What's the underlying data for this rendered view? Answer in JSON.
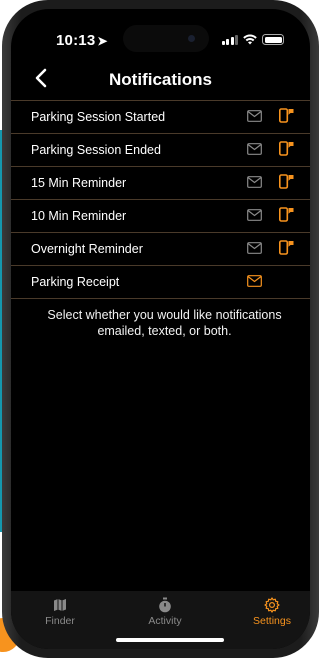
{
  "status_bar": {
    "time": "10:13"
  },
  "header": {
    "title": "Notifications"
  },
  "notification_rows": [
    {
      "label": "Parking Session Started",
      "email_enabled": false,
      "text_enabled": true
    },
    {
      "label": "Parking Session Ended",
      "email_enabled": false,
      "text_enabled": true
    },
    {
      "label": "15 Min Reminder",
      "email_enabled": false,
      "text_enabled": true
    },
    {
      "label": "10 Min Reminder",
      "email_enabled": false,
      "text_enabled": true
    },
    {
      "label": "Overnight Reminder",
      "email_enabled": false,
      "text_enabled": true
    },
    {
      "label": "Parking Receipt",
      "email_enabled": true,
      "text_enabled": false
    }
  ],
  "helper_text": "Select whether you would like notifications emailed, texted, or both.",
  "tabs": [
    {
      "label": "Finder",
      "icon": "map-icon"
    },
    {
      "label": "Activity",
      "icon": "stopwatch-icon"
    },
    {
      "label": "Settings",
      "icon": "gear-icon",
      "active": true
    }
  ],
  "colors": {
    "accent": "#f7931e",
    "inactive_icon": "#8a8a8a",
    "background": "#000000",
    "divider": "#4a3a2a"
  }
}
